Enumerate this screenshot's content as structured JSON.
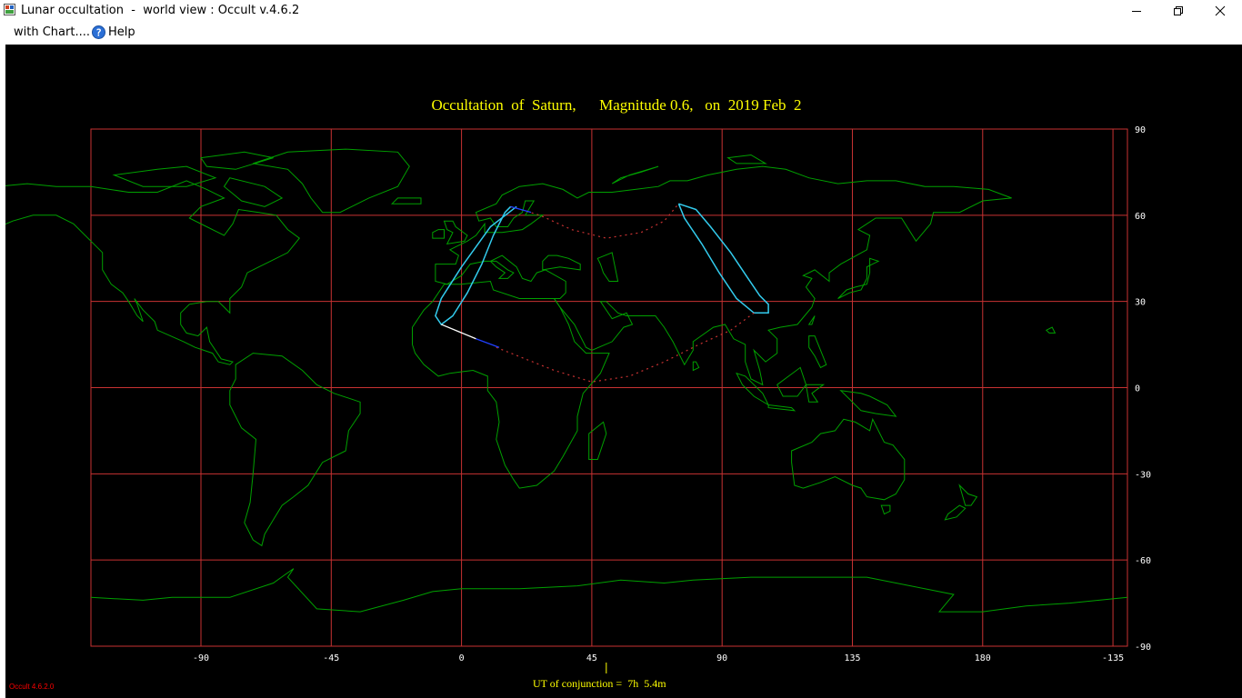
{
  "window": {
    "title": "Lunar occultation  -  world view : Occult v.4.6.2",
    "minimize_icon": "minimize-icon",
    "restore_icon": "restore-icon",
    "close_icon": "close-icon"
  },
  "menu": {
    "items": [
      "with Chart....",
      "Help"
    ]
  },
  "chart": {
    "title": "Occultation  of  Saturn,      Magnitude 0.6,   on  2019 Feb  2",
    "conjunction": "UT of conjunction =  7h  5.4m",
    "version": "Occult 4.6.2.0"
  },
  "colors": {
    "background": "#000000",
    "grid": "#c83232",
    "coastline": "#00a000",
    "path": "#33ccee",
    "text": "#ffff00",
    "axis_labels": "#ffffff"
  },
  "chart_data": {
    "type": "map",
    "projection": "equirectangular",
    "x_ticks": [
      "-90",
      "-45",
      "0",
      "45",
      "90",
      "135",
      "180",
      "-135"
    ],
    "y_ticks": [
      "90",
      "60",
      "30",
      "0",
      "-30",
      "-60",
      "-90"
    ],
    "lon_range": [
      -128,
      230
    ],
    "lat_range": [
      -90,
      90
    ],
    "occultation_path_west": [
      [
        19,
        63
      ],
      [
        10,
        56
      ],
      [
        0,
        42
      ],
      [
        -7,
        31
      ],
      [
        -9,
        25
      ],
      [
        -7,
        22
      ],
      [
        -3,
        25
      ],
      [
        2,
        33
      ],
      [
        7,
        43
      ],
      [
        11,
        53
      ],
      [
        15,
        61
      ],
      [
        17,
        63
      ]
    ],
    "occultation_path_east": [
      [
        75,
        64
      ],
      [
        81,
        62
      ],
      [
        86,
        56
      ],
      [
        93,
        47
      ],
      [
        99,
        38
      ],
      [
        103,
        32
      ],
      [
        106,
        29
      ],
      [
        106,
        26
      ],
      [
        101,
        26
      ],
      [
        95,
        31
      ],
      [
        89,
        40
      ],
      [
        83,
        50
      ],
      [
        77,
        59
      ],
      [
        75,
        64
      ]
    ],
    "rise_set_north": [
      [
        17,
        63
      ],
      [
        27,
        60
      ],
      [
        38,
        55
      ],
      [
        50,
        52
      ],
      [
        62,
        54
      ],
      [
        70,
        58
      ],
      [
        75,
        64
      ]
    ],
    "rise_set_south": [
      [
        12,
        14
      ],
      [
        22,
        10
      ],
      [
        32,
        6
      ],
      [
        45,
        2
      ],
      [
        58,
        4
      ],
      [
        70,
        9
      ],
      [
        82,
        15
      ],
      [
        93,
        20
      ],
      [
        101,
        26
      ]
    ]
  }
}
